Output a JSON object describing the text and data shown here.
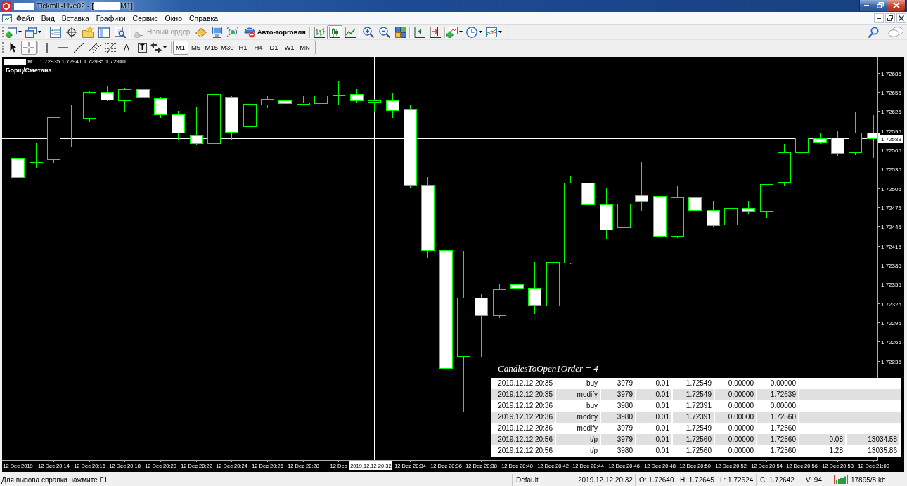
{
  "window": {
    "title_text": "Tickmill-Live02 - [",
    "title_suffix": "M1]"
  },
  "menu": {
    "items": [
      "Файл",
      "Вид",
      "Вставка",
      "Графики",
      "Сервис",
      "Окно",
      "Справка"
    ]
  },
  "main_toolbar": {
    "new_order_button": {
      "label": "Новый ордер",
      "disabled": true
    },
    "autotrading_button": {
      "label": "Авто-торговля"
    },
    "chart_type_buttons": [
      {
        "selected": false
      },
      {
        "selected": true
      },
      {
        "selected": false
      }
    ]
  },
  "drawing_toolbar": {
    "pointer_tools": [
      {
        "selected": false
      },
      {
        "selected": true
      }
    ],
    "text_tools": [
      "A",
      "T"
    ],
    "timeframes": [
      {
        "label": "M1",
        "selected": true
      },
      {
        "label": "M5",
        "selected": false
      },
      {
        "label": "M15",
        "selected": false
      },
      {
        "label": "M30",
        "selected": false
      },
      {
        "label": "H1",
        "selected": false
      },
      {
        "label": "H4",
        "selected": false
      },
      {
        "label": "D1",
        "selected": false
      },
      {
        "label": "W1",
        "selected": false
      },
      {
        "label": "MN",
        "selected": false
      }
    ]
  },
  "chart": {
    "symbol_label": ",M1",
    "ohlc_readout": "1.72935 1.72941 1.72935 1.72940",
    "expert_label": "Борщ/Сметана",
    "comment": "CandlesToOpen1Order = 4",
    "chart_data": [
      {
        "type": "candlestick",
        "x": [
          "2019-12-12T20:12",
          "2019-12-12T20:13",
          "2019-12-12T20:14",
          "2019-12-12T20:15",
          "2019-12-12T20:16",
          "2019-12-12T20:17",
          "2019-12-12T20:18",
          "2019-12-12T20:19",
          "2019-12-12T20:20",
          "2019-12-12T20:21",
          "2019-12-12T20:22",
          "2019-12-12T20:23",
          "2019-12-12T20:24",
          "2019-12-12T20:25",
          "2019-12-12T20:26",
          "2019-12-12T20:27",
          "2019-12-12T20:28",
          "2019-12-12T20:29",
          "2019-12-12T20:30",
          "2019-12-12T20:31",
          "2019-12-12T20:32",
          "2019-12-12T20:33",
          "2019-12-12T20:34",
          "2019-12-12T20:35",
          "2019-12-12T20:36",
          "2019-12-12T20:37",
          "2019-12-12T20:38",
          "2019-12-12T20:39",
          "2019-12-12T20:40",
          "2019-12-12T20:41",
          "2019-12-12T20:42",
          "2019-12-12T20:43",
          "2019-12-12T20:44",
          "2019-12-12T20:45",
          "2019-12-12T20:46",
          "2019-12-12T20:47",
          "2019-12-12T20:48",
          "2019-12-12T20:49",
          "2019-12-12T20:50",
          "2019-12-12T20:51",
          "2019-12-12T20:52",
          "2019-12-12T20:53",
          "2019-12-12T20:54",
          "2019-12-12T20:55",
          "2019-12-12T20:56",
          "2019-12-12T20:57",
          "2019-12-12T20:58",
          "2019-12-12T20:59",
          "2019-12-12T21:00"
        ],
        "ohlc": [
          [
            1.72552,
            1.72553,
            1.72484,
            1.72522
          ],
          [
            1.72545,
            1.72576,
            1.72538,
            1.72547
          ],
          [
            1.7255,
            1.72616,
            1.72545,
            1.72616
          ],
          [
            1.72613,
            1.72636,
            1.72569,
            1.72613
          ],
          [
            1.72614,
            1.72658,
            1.72609,
            1.72655
          ],
          [
            1.72655,
            1.72665,
            1.72642,
            1.72643
          ],
          [
            1.72642,
            1.72662,
            1.72625,
            1.7266
          ],
          [
            1.7266,
            1.72663,
            1.72642,
            1.72647
          ],
          [
            1.72645,
            1.72648,
            1.72616,
            1.7262
          ],
          [
            1.7262,
            1.72627,
            1.7258,
            1.72591
          ],
          [
            1.72588,
            1.72632,
            1.72573,
            1.72575
          ],
          [
            1.72575,
            1.72661,
            1.72573,
            1.72652
          ],
          [
            1.72647,
            1.72651,
            1.72582,
            1.72593
          ],
          [
            1.72601,
            1.7264,
            1.72598,
            1.72636
          ],
          [
            1.72635,
            1.7265,
            1.72631,
            1.72644
          ],
          [
            1.72642,
            1.72661,
            1.72635,
            1.72638
          ],
          [
            1.72637,
            1.72651,
            1.72635,
            1.72639
          ],
          [
            1.72638,
            1.72656,
            1.72635,
            1.7265
          ],
          [
            1.72651,
            1.72673,
            1.72637,
            1.72651
          ],
          [
            1.72652,
            1.72661,
            1.72639,
            1.72642
          ],
          [
            1.7264,
            1.72645,
            1.72624,
            1.72642
          ],
          [
            1.72642,
            1.72655,
            1.72616,
            1.72627
          ],
          [
            1.72629,
            1.72635,
            1.72507,
            1.72509
          ],
          [
            1.72509,
            1.72523,
            1.72397,
            1.72408
          ],
          [
            1.72408,
            1.72439,
            1.72104,
            1.72224
          ],
          [
            1.72242,
            1.72408,
            1.72156,
            1.72334
          ],
          [
            1.72334,
            1.7234,
            1.72242,
            1.72306
          ],
          [
            1.72306,
            1.72357,
            1.72303,
            1.72347
          ],
          [
            1.72354,
            1.72404,
            1.72321,
            1.72349
          ],
          [
            1.72349,
            1.72391,
            1.72309,
            1.72323
          ],
          [
            1.72321,
            1.72391,
            1.7232,
            1.7239
          ],
          [
            1.72388,
            1.72526,
            1.72387,
            1.72513
          ],
          [
            1.72513,
            1.72527,
            1.72461,
            1.72479
          ],
          [
            1.7248,
            1.72507,
            1.72426,
            1.7244
          ],
          [
            1.72444,
            1.72483,
            1.72441,
            1.72481
          ],
          [
            1.72494,
            1.72547,
            1.7247,
            1.72485
          ],
          [
            1.72493,
            1.72523,
            1.72414,
            1.7243
          ],
          [
            1.7243,
            1.72509,
            1.72428,
            1.72491
          ],
          [
            1.72491,
            1.72518,
            1.72462,
            1.72471
          ],
          [
            1.72471,
            1.72486,
            1.72445,
            1.72447
          ],
          [
            1.72448,
            1.72489,
            1.72446,
            1.72474
          ],
          [
            1.72474,
            1.72486,
            1.72466,
            1.72469
          ],
          [
            1.72469,
            1.72512,
            1.72459,
            1.72511
          ],
          [
            1.72515,
            1.72575,
            1.72509,
            1.72561
          ],
          [
            1.72561,
            1.72598,
            1.7254,
            1.72584
          ],
          [
            1.72583,
            1.72593,
            1.72575,
            1.72577
          ],
          [
            1.72584,
            1.72596,
            1.72556,
            1.7256
          ],
          [
            1.72561,
            1.72624,
            1.72559,
            1.72591
          ],
          [
            1.72591,
            1.7262,
            1.72553,
            1.72583
          ]
        ],
        "xlim": [
          "2019-12-12T20:11:07",
          "2019-12-12T21:00:15"
        ],
        "ylim": [
          1.7208,
          1.7271
        ],
        "yticks": [
          1.72685,
          1.72655,
          1.72625,
          1.72595,
          1.72565,
          1.72535,
          1.72505,
          1.72475,
          1.72445,
          1.72415,
          1.72385,
          1.72355,
          1.72325,
          1.72295,
          1.72265,
          1.72235
        ],
        "xticks": [
          {
            "value": "2019-12-12T20:12",
            "label": "12 Dec 2019"
          },
          {
            "value": "2019-12-12T20:14",
            "label": "12 Dec 20:14"
          },
          {
            "value": "2019-12-12T20:16",
            "label": "12 Dec 20:16"
          },
          {
            "value": "2019-12-12T20:18",
            "label": "12 Dec 20:18"
          },
          {
            "value": "2019-12-12T20:20",
            "label": "12 Dec 20:20"
          },
          {
            "value": "2019-12-12T20:22",
            "label": "12 Dec 20:22"
          },
          {
            "value": "2019-12-12T20:24",
            "label": "12 Dec 20:24"
          },
          {
            "value": "2019-12-12T20:26",
            "label": "12 Dec 20:26"
          },
          {
            "value": "2019-12-12T20:28",
            "label": "12 Dec 20:28"
          },
          {
            "value": "2019-12-12T20:30",
            "label": "12 Dec"
          },
          {
            "value": "2019-12-12T20:34",
            "label": "12 Dec 20:34"
          },
          {
            "value": "2019-12-12T20:36",
            "label": "12 Dec 20:36"
          },
          {
            "value": "2019-12-12T20:38",
            "label": "12 Dec 20:38"
          },
          {
            "value": "2019-12-12T20:40",
            "label": "12 Dec 20:40"
          },
          {
            "value": "2019-12-12T20:42",
            "label": "12 Dec 20:42"
          },
          {
            "value": "2019-12-12T20:44",
            "label": "12 Dec 20:44"
          },
          {
            "value": "2019-12-12T20:46",
            "label": "12 Dec 20:46"
          },
          {
            "value": "2019-12-12T20:48",
            "label": "12 Dec 20:48"
          },
          {
            "value": "2019-12-12T20:50",
            "label": "12 Dec 20:50"
          },
          {
            "value": "2019-12-12T20:52",
            "label": "12 Dec 20:52"
          },
          {
            "value": "2019-12-12T20:54",
            "label": "12 Dec 20:54"
          },
          {
            "value": "2019-12-12T20:56",
            "label": "12 Dec 20:56"
          },
          {
            "value": "2019-12-12T20:58",
            "label": "12 Dec 20:58"
          },
          {
            "value": "2019-12-12T21:00",
            "label": "12 Dec 21:00"
          }
        ],
        "ref_lines": [
          {
            "axis": "y",
            "value": 1.72583,
            "label": "1.72583",
            "color": "#ffffff"
          },
          {
            "axis": "x",
            "value": "2019-12-12T20:32",
            "label": "2019.12.12 20:32",
            "color": "#ffffff"
          }
        ]
      }
    ],
    "trade_log": {
      "rows": [
        [
          "2019.12.12 20:35",
          "buy",
          "3979",
          "0.01",
          "1.72549",
          "0.00000",
          "0.00000"
        ],
        [
          "2019.12.12 20:35",
          "modify",
          "3979",
          "0.01",
          "1.72549",
          "0.00000",
          "1.72639"
        ],
        [
          "2019.12.12 20:36",
          "buy",
          "3980",
          "0.01",
          "1.72391",
          "0.00000",
          "0.00000"
        ],
        [
          "2019.12.12 20:36",
          "modify",
          "3980",
          "0.01",
          "1.72391",
          "0.00000",
          "1.72560"
        ],
        [
          "2019.12.12 20:36",
          "modify",
          "3979",
          "0.01",
          "1.72549",
          "0.00000",
          "1.72560"
        ],
        [
          "2019.12.12 20:56",
          "t/p",
          "3979",
          "0.01",
          "1.72560",
          "0.00000",
          "1.72560",
          "0.08",
          "13034.58"
        ],
        [
          "2019.12.12 20:56",
          "t/p",
          "3980",
          "0.01",
          "1.72560",
          "0.00000",
          "1.72560",
          "1.28",
          "13035.86"
        ]
      ]
    }
  },
  "status_bar": {
    "help_text": "Для вызова справки нажмите F1",
    "profile": "Default",
    "datetime": "2019.12.12 20:32",
    "open": "O: 1.72640",
    "high": "H: 1.72645",
    "low": "L: 1.72624",
    "close": "C: 1.72642",
    "volume": "V: 94",
    "traffic": "17895/8 kb"
  }
}
